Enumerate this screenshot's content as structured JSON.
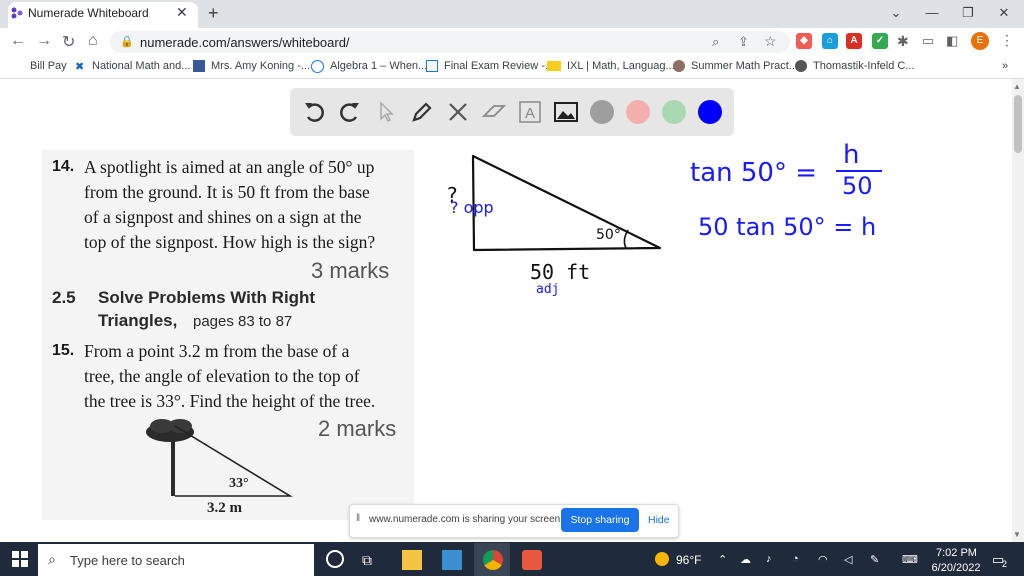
{
  "browser": {
    "tab_title": "Numerade Whiteboard",
    "url": "numerade.com/answers/whiteboard/",
    "profile_initial": "E"
  },
  "bookmarks": [
    {
      "label": "Bill Pay"
    },
    {
      "label": "National Math and..."
    },
    {
      "label": "Mrs. Amy Koning -..."
    },
    {
      "label": "Algebra 1 – When..."
    },
    {
      "label": "Final Exam Review -..."
    },
    {
      "label": "IXL | Math, Languag..."
    },
    {
      "label": "Summer Math Pract..."
    },
    {
      "label": "Thomastik-Infeld C..."
    }
  ],
  "whiteboard": {
    "tools": [
      "undo-icon",
      "redo-icon",
      "pointer-icon",
      "pen-icon",
      "tools-icon",
      "eraser-icon",
      "text-icon",
      "image-icon"
    ],
    "colors": [
      "#9e9e9e",
      "#f4b0ad",
      "#a9d8b1",
      "#0000ff"
    ],
    "handwriting": {
      "side_label": "? opp",
      "angle": "50°",
      "base": "50 ft",
      "adj": "adj",
      "eq1_left": "tan 50° =",
      "eq1_num": "h",
      "eq1_den": "50",
      "eq2": "50 tan 50° = h"
    }
  },
  "textbook": {
    "q14_num": "14.",
    "q14_lines": [
      "A spotlight is aimed at an angle of 50° up",
      "from the ground. It is 50 ft from the base",
      "of a signpost and shines on a sign at the",
      "top of the signpost. How high is the sign?"
    ],
    "q14_marks": "3 marks",
    "section_num": "2.5",
    "section_title_1": "Solve Problems With Right",
    "section_title_2": "Triangles,",
    "section_pages": "pages 83 to 87",
    "q15_num": "15.",
    "q15_lines": [
      "From a point 3.2 m from the base of a",
      "tree, the angle of elevation to the top of",
      "the tree is 33°. Find the height of the tree."
    ],
    "q15_marks": "2 marks",
    "fig_angle": "33°",
    "fig_base": "3.2 m"
  },
  "sharebar": {
    "text": "www.numerade.com is sharing your screen.",
    "stop": "Stop sharing",
    "hide": "Hide"
  },
  "taskbar": {
    "search_placeholder": "Type here to search",
    "weather": "96°F",
    "time": "7:02 PM",
    "date": "6/20/2022",
    "notifications": "2"
  }
}
